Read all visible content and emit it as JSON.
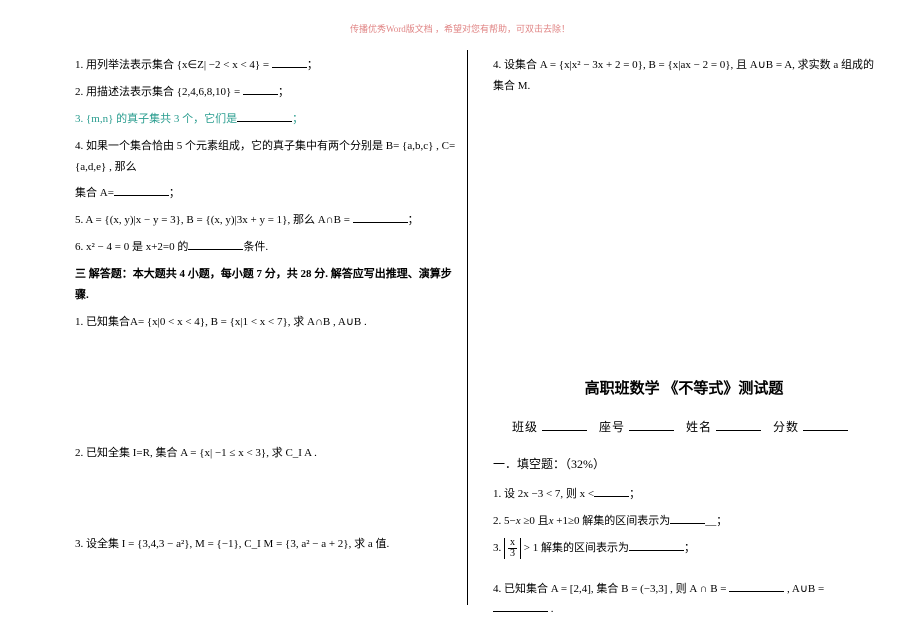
{
  "header_notice": "传播优秀Word版文档 ，希望对您有帮助，可双击去除！",
  "left": {
    "q1": "1. 用列举法表示集合 {x∈Z| −2 < x < 4} = ",
    "q1_tail": "；",
    "q2": "2. 用描述法表示集合 {2,4,6,8,10} = ",
    "q2_tail": "；",
    "q3": "3. {m,n} 的真子集共 3 个，它们是",
    "q3_tail": "；",
    "q4a": "4. 如果一个集合恰由 5 个元素组成，它的真子集中有两个分别是 B= {a,b,c} , C= {a,d,e} , 那么",
    "q4b": "集合 A=",
    "q4b_tail": "；",
    "q5": "5. A = {(x, y)|x − y = 3}, B = {(x, y)|3x + y = 1}, 那么 A∩B = ",
    "q5_tail": "；",
    "q6": "6. x² − 4 = 0  是 x+2=0 的",
    "q6_tail": "条件.",
    "sec3": "三  解答题：本大题共 4 小题，每小题 7 分，共 28 分. 解答应写出推理、演算步骤.",
    "s1": "1. 已知集合A= {x|0 < x < 4}, B = {x|1 < x < 7}, 求 A∩B , A∪B .",
    "s2": "2. 已知全集 I=R, 集合 A = {x| −1 ≤ x < 3}, 求 C_I A .",
    "s3": "3. 设全集 I = {3,4,3 − a²}, M = {−1}, C_I M = {3, a² − a + 2}, 求 a 值."
  },
  "right": {
    "r4": "4. 设集合 A = {x|x² − 3x + 2 = 0}, B = {x|ax − 2 = 0}, 且 A∪B = A, 求实数 a 组成的集合 M.",
    "title": "高职班数学 《不等式》测试题",
    "label_class": "班级",
    "label_seat": "座号",
    "label_name": "姓名",
    "label_score": "分数",
    "sec1": "一．填空题：（32%）",
    "f1": "1. 设 2x −3 < 7, 则 x <",
    "f1_tail": "；",
    "f2_a": "2.  5−",
    "f2_b": "≥0 且",
    "f2_c": "+1≥0 解集的区间表示为",
    "f2_tail": "；",
    "f3_a": "3.  ",
    "f3_b": "> 1 解集的区间表示为",
    "f3_tail": "；",
    "f4": "4. 已知集合 A = [2,4], 集合 B = (−3,3] , 则 A ∩ B = ",
    "f4_mid": " , A∪B = ",
    "f4_tail": "."
  }
}
